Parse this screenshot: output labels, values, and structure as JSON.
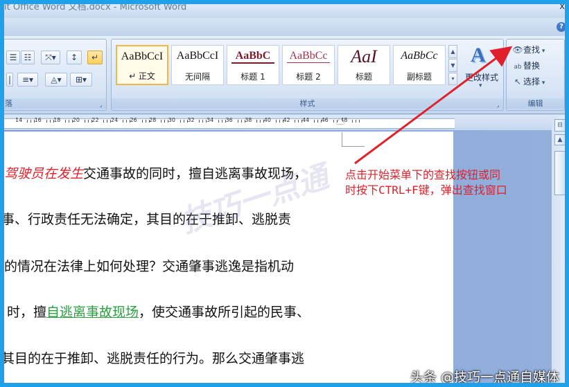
{
  "window": {
    "title": "it Office Word 文档.docx - Microsoft Word",
    "close_glyph": "x",
    "help_glyph": "?"
  },
  "ribbon": {
    "paragraph_group": {
      "label": "落",
      "launcher_glyph": "⌟"
    },
    "styles_group": {
      "label": "样式",
      "launcher_glyph": "⌟",
      "gallery": [
        {
          "sample": "AaBbCcI",
          "name": "↵ 正文",
          "selected": true
        },
        {
          "sample": "AaBbCcI",
          "name": "无间隔",
          "selected": false
        },
        {
          "sample": "AaBbC",
          "name": "标题 1",
          "selected": false
        },
        {
          "sample": "AaBbCc",
          "name": "标题 2",
          "selected": false
        },
        {
          "sample": "AaI",
          "name": "标题",
          "selected": false
        },
        {
          "sample": "AaBbCc",
          "name": "副标题",
          "selected": false
        }
      ],
      "change_styles_label": "更改样式",
      "change_styles_glyph": "A"
    },
    "editing_group": {
      "label": "编辑",
      "find_label": "查找",
      "replace_label": "替换",
      "select_label": "选择"
    }
  },
  "ruler": {
    "numbers": [
      "14",
      "16",
      "18",
      "20",
      "22",
      "24",
      "26",
      "28",
      "30",
      "32",
      "34",
      "36",
      "38",
      "40",
      "42",
      "44",
      "46",
      "48"
    ]
  },
  "document": {
    "line1_red": "驾驶员在发生",
    "line1_rest": "交通事故的同时，擅自逃离事故现场，",
    "line2": "事、行政责任无法确定，其目的在于推卸、逃脱责",
    "line3": "的情况在法律上如何处理？交通肇事逃逸是指机动",
    "line4_pre": "时，擅",
    "line4_link": "自逃离事故现场",
    "line4_post": "，使交通事故所引起的民事、",
    "line5": "其目的在于推卸、逃脱责任的行为。那么交通肇事逃",
    "watermark": "技巧一点通"
  },
  "annotation": {
    "line1": "点击开始菜单下的查找按钮或同",
    "line2": "时按下CTRL+F键，弹出查找窗口"
  },
  "footer": {
    "attribution": "头条 @技巧一点通自媒体"
  },
  "colors": {
    "frame_border": "#1fa0e8",
    "annotation_red": "#e0202a",
    "link_green": "#2aa040"
  }
}
